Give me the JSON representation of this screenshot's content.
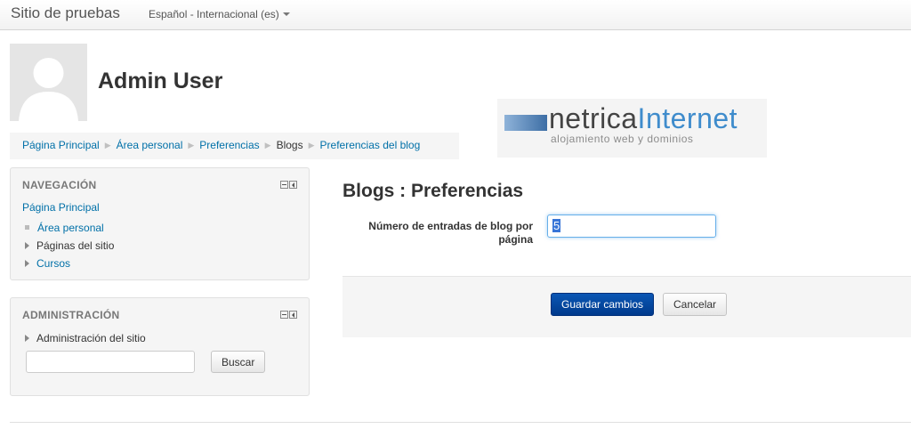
{
  "navbar": {
    "brand": "Sitio de pruebas",
    "language": "Español - Internacional (es)"
  },
  "header": {
    "user_name": "Admin User"
  },
  "breadcrumb": {
    "items": [
      "Página Principal",
      "Área personal",
      "Preferencias",
      "Blogs",
      "Preferencias del blog"
    ]
  },
  "logo": {
    "name_part1": "netrica",
    "name_part2": "Internet",
    "tagline": "alojamiento web y dominios"
  },
  "navigation_block": {
    "title": "NAVEGACIÓN",
    "home": "Página Principal",
    "items": [
      "Área personal",
      "Páginas del sitio",
      "Cursos"
    ]
  },
  "admin_block": {
    "title": "ADMINISTRACIÓN",
    "item": "Administración del sitio",
    "search_value": "",
    "search_button": "Buscar"
  },
  "main": {
    "heading": "Blogs : Preferencias",
    "field_label": "Número de entradas de blog por página",
    "field_value": "5",
    "save_button": "Guardar cambios",
    "cancel_button": "Cancelar"
  },
  "colors": {
    "link": "#0070a8",
    "primary_button": "#003a8c",
    "panel": "#f5f5f5"
  }
}
